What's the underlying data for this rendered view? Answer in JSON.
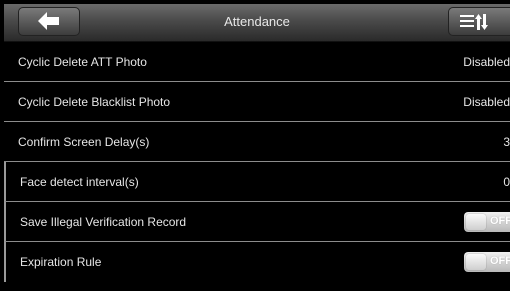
{
  "header": {
    "title": "Attendance",
    "back_icon": "back-arrow-icon",
    "menu_icon": "sort-menu-icon"
  },
  "settings": [
    {
      "label": "Cyclic Delete ATT Photo",
      "value": "Disabled"
    },
    {
      "label": "Cyclic Delete Blacklist Photo",
      "value": "Disabled"
    },
    {
      "label": "Confirm Screen Delay(s)",
      "value": "3"
    },
    {
      "label": "Face detect interval(s)",
      "value": "0"
    },
    {
      "label": "Save Illegal Verification Record",
      "toggle": "OFF"
    },
    {
      "label": "Expiration Rule",
      "toggle": "OFF"
    }
  ],
  "colors": {
    "background": "#000000",
    "text": "#e6e6e6",
    "separator": "#8c8c8c"
  }
}
